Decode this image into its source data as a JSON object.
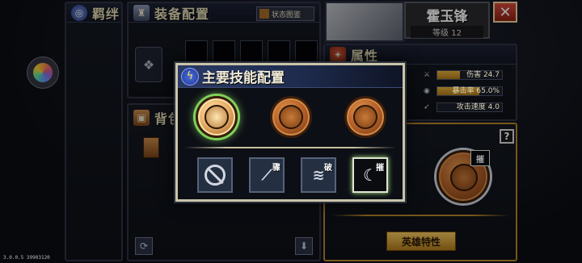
{
  "tabs": {
    "bond": "羁绊",
    "equipment": "装备配置",
    "bag": "背包",
    "attributes": "属性"
  },
  "status_button": "状态图鉴",
  "hero": {
    "name": "霍玉锋",
    "level": "等级 12"
  },
  "stats": [
    {
      "label": "伤害",
      "value": "24.7",
      "fill": 0.35,
      "icon": "sword-icon"
    },
    {
      "label": "暴击率",
      "value": "65.0%",
      "fill": 0.65,
      "icon": "eye-icon"
    },
    {
      "label": "攻击速度",
      "value": "4.0",
      "fill": 0.0,
      "icon": "wing-icon"
    }
  ],
  "modal": {
    "title": "主要技能配置",
    "medals": [
      "medal-1",
      "medal-2",
      "medal-3"
    ],
    "skills": [
      {
        "icon": "disabled-icon",
        "tag": ""
      },
      {
        "icon": "slash-skill-icon",
        "tag": "骤"
      },
      {
        "icon": "break-skill-icon",
        "tag": "破"
      },
      {
        "icon": "claw-skill-icon",
        "tag": "摧"
      }
    ]
  },
  "skill_panel": {
    "help": "?",
    "badge": "摧"
  },
  "hero_trait_button": "英雄特性",
  "version": "3.0.0.5 39903120",
  "colors": {
    "accent_gold": "#f4c960",
    "close_red": "#d64a3a",
    "modal_header_blue": "#2a3a66",
    "selected_glow": "#7ed35a"
  }
}
